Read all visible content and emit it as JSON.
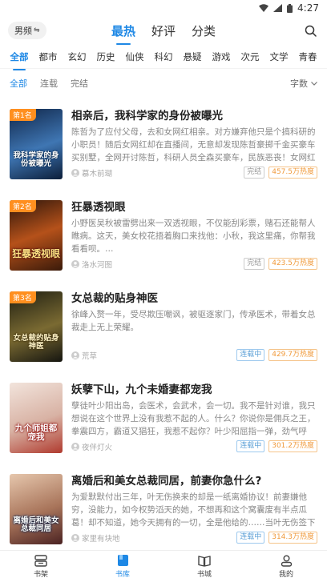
{
  "status": {
    "time": "4:27"
  },
  "header": {
    "gender_label": "男频",
    "tabs": [
      "最热",
      "好评",
      "分类"
    ],
    "active_tab": 0
  },
  "categories": [
    "全部",
    "都市",
    "玄幻",
    "历史",
    "仙侠",
    "科幻",
    "悬疑",
    "游戏",
    "次元",
    "文学",
    "青春"
  ],
  "filters": {
    "items": [
      "全部",
      "连载",
      "完结"
    ],
    "sort_label": "字数"
  },
  "books": [
    {
      "rank": "第1名",
      "cover_text": "我科学家的身份被曝光",
      "title": "相亲后，我科学家的身份被曝光",
      "desc": "陈哲为了应付父母，去和女网红相亲。对方嫌弃他只是个搞科研的小职员！随后女网红却在直播间，无意却发现陈哲豪掷千金买豪车买别墅，全网开讨陈哲，科研人员全森买豪车，民族恶丧！女网红更是发动粉…",
      "author": "慕木前瑚",
      "status": "完结",
      "heat": "457.5万热度",
      "cover_colors": [
        "#1b3c6e",
        "#4e7fb8"
      ]
    },
    {
      "rank": "第2名",
      "cover_text": "狂暴透视眼",
      "title": "狂暴透视眼",
      "desc": "小野医吴秋被雷劈出来一双透视眼，不仅能刮彩票，赌石还能帮人瞧病。这天，美女校花捂着胸口来找他：小秋，我这里痛，你帮我看看呗。…",
      "author": "洛水河图",
      "status": "完结",
      "heat": "423.5万热度",
      "cover_colors": [
        "#3b1d10",
        "#c45a1c"
      ]
    },
    {
      "rank": "第3名",
      "cover_text": "女总裁的贴身神医",
      "title": "女总裁的贴身神医",
      "desc": "徐峰入赘一年，受尽欺压嘲讽，被驱逐家门，传承医术，带着女总裁走上无上荣耀。",
      "author": "荒草",
      "status": "连载中",
      "heat": "429.7万热度",
      "cover_colors": [
        "#2a2a1a",
        "#8a7a3a"
      ]
    },
    {
      "rank": "",
      "cover_text": "九个师姐都宠我",
      "title": "妖孽下山，九个未婚妻都宠我",
      "desc": "孽徒叶少阳出岛，会医术，会武术，会一切。我不是针对谁，我只想说在这个世界上没有我惹不起的人。什么？你说你是佣兵之王，拳震四方，霸道又猖狂，我惹不起你？叶少阳屈指一弹，劲气呼啸，佣兵之…",
      "author": "夜伴灯火",
      "status": "连载中",
      "heat": "301.2万热度",
      "cover_colors": [
        "#e8d8d0",
        "#c0463a"
      ]
    },
    {
      "rank": "",
      "cover_text": "离婚后和美女总裁同居",
      "title": "离婚后和美女总裁同居，前妻你急什么?",
      "desc": "为爱默默付出三年，叶无伤换来的却是一纸离婚协议！前妻嫌他穷，没能力，如今权势滔天的她，不想再和这个窝囊废有半点瓜葛！却不知道，她今天拥有的一切，全是他给的……当叶无伤签下离婚协议那一…",
      "author": "家里有块地",
      "status": "连载中",
      "heat": "314.3万热度",
      "cover_colors": [
        "#d9b59a",
        "#5a2a2a"
      ]
    }
  ],
  "bottom_nav": {
    "items": [
      "书架",
      "书库",
      "书城",
      "我的"
    ],
    "active": 1
  },
  "colors": {
    "accent": "#1e88e5",
    "rank": "#ff8f1f",
    "heat": "#f09a3b"
  }
}
